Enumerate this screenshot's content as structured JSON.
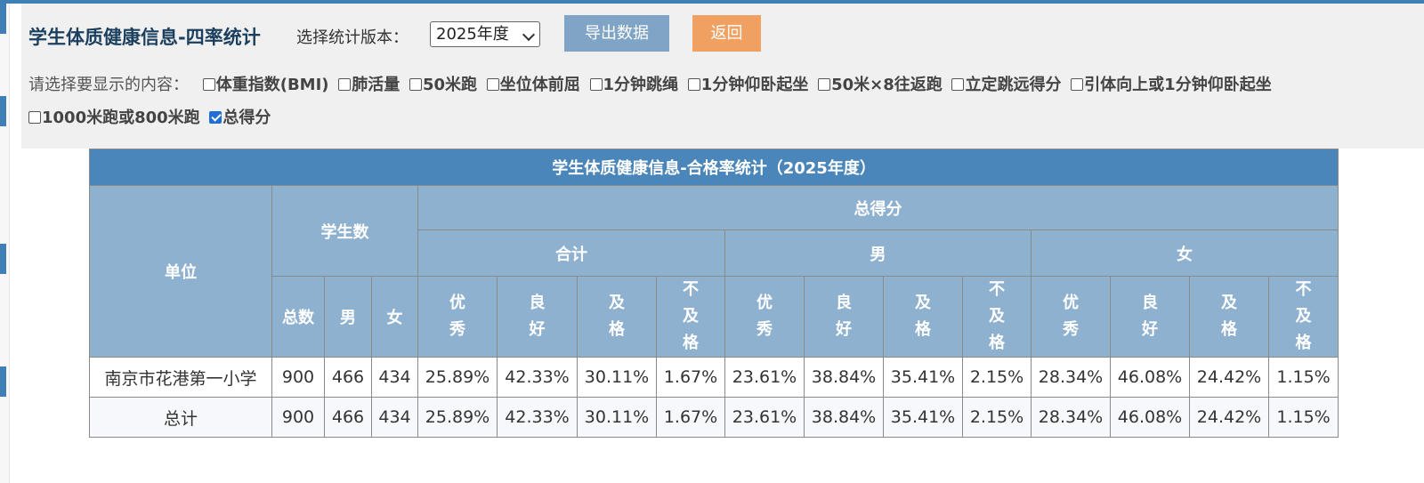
{
  "header": {
    "title": "学生体质健康信息-四率统计",
    "version_label": "选择统计版本：",
    "version_selected": "2025年度",
    "export_label": "导出数据",
    "back_label": "返回"
  },
  "options": {
    "prompt": "请选择要显示的内容：",
    "items": [
      {
        "label": "体重指数(BMI)",
        "checked": false
      },
      {
        "label": "肺活量",
        "checked": false
      },
      {
        "label": "50米跑",
        "checked": false
      },
      {
        "label": "坐位体前屈",
        "checked": false
      },
      {
        "label": "1分钟跳绳",
        "checked": false
      },
      {
        "label": "1分钟仰卧起坐",
        "checked": false
      },
      {
        "label": "50米×8往返跑",
        "checked": false
      },
      {
        "label": "立定跳远得分",
        "checked": false
      },
      {
        "label": "引体向上或1分钟仰卧起坐",
        "checked": false
      },
      {
        "label": "1000米跑或800米跑",
        "checked": false
      },
      {
        "label": "总得分",
        "checked": true
      }
    ]
  },
  "table": {
    "caption": "学生体质健康信息-合格率统计（2025年度）",
    "unit_header": "单位",
    "students_header": "学生数",
    "score_header": "总得分",
    "group_total": "合计",
    "group_male": "男",
    "group_female": "女",
    "sub_total": "总数",
    "sub_male": "男",
    "sub_female": "女",
    "levels": [
      "优秀",
      "良好",
      "及格",
      "不及格"
    ],
    "rows": [
      {
        "unit": "南京市花港第一小学",
        "total": "900",
        "male": "466",
        "female": "434",
        "values": [
          "25.89%",
          "42.33%",
          "30.11%",
          "1.67%",
          "23.61%",
          "38.84%",
          "35.41%",
          "2.15%",
          "28.34%",
          "46.08%",
          "24.42%",
          "1.15%"
        ]
      },
      {
        "unit": "总计",
        "total": "900",
        "male": "466",
        "female": "434",
        "values": [
          "25.89%",
          "42.33%",
          "30.11%",
          "1.67%",
          "23.61%",
          "38.84%",
          "35.41%",
          "2.15%",
          "28.34%",
          "46.08%",
          "24.42%",
          "1.15%"
        ]
      }
    ]
  },
  "colors": {
    "caption_bg": "#4a86b9",
    "header_bg": "#8fb1d0",
    "export_btn": "#7fa4c5",
    "back_btn": "#f0a060"
  }
}
